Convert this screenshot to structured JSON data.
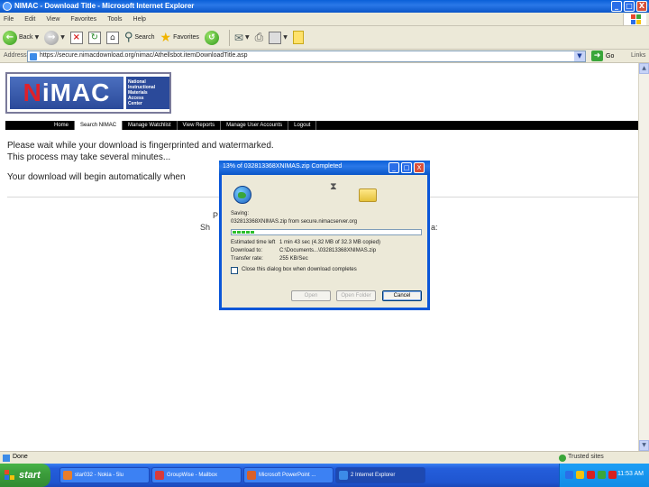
{
  "window": {
    "title": "NIMAC - Download Title - Microsoft Internet Explorer",
    "minimize": "_",
    "maximize": "□",
    "close": "X"
  },
  "menu": [
    "File",
    "Edit",
    "View",
    "Favorites",
    "Tools",
    "Help"
  ],
  "toolbar": {
    "back": "Back",
    "search": "Search",
    "favorites": "Favorites"
  },
  "address": {
    "label": "Address",
    "url": "https://secure.nimacdownload.org/nimac/Athellsbot.itemDownloadTitle.asp",
    "go": "Go",
    "links": "Links"
  },
  "logo": {
    "brand": "NiMAC",
    "subtitle_lines": [
      "National",
      "Instructional",
      "Materials",
      "Access",
      "Center"
    ]
  },
  "nav": [
    "Home",
    "Search NIMAC",
    "Manage Watchlist",
    "View Reports",
    "Manage User Accounts",
    "Logout"
  ],
  "nav_active_index": 1,
  "messages": {
    "line1": "Please wait while your download is fingerprinted and watermarked.",
    "line2": "This process may take several minutes...",
    "line3": "Your download will begin automatically when",
    "frag1": "P",
    "frag2": "Sh",
    "frag3": "a:"
  },
  "dialog": {
    "title": "13% of 032813368XNIMAS.zip Completed",
    "minimize": "_",
    "maximize": "□",
    "close": "X",
    "status": "Saving:",
    "file_from": "032813368XNIMAS.zip from secure.nimacserver.org",
    "progress_fraction": 0.13,
    "est_label": "Estimated time left",
    "est_value": "1 min 43 sec (4.32 MB of 32.3 MB copied)",
    "dl_label": "Download to:",
    "dl_value": "C:\\Documents...\\032813368XNIMAS.zip",
    "rate_label": "Transfer rate:",
    "rate_value": "255 KB/Sec",
    "checkbox_label": "Close this dialog box when download completes",
    "open_btn": "Open",
    "open_folder_btn": "Open Folder",
    "cancel_btn": "Cancel"
  },
  "statusbar": {
    "text": "Done",
    "zone": "Trusted sites"
  },
  "taskbar": {
    "start": "start",
    "tasks": [
      "star032 - Nokia - 5lu",
      "GroupWise - Mailbox",
      "Microsoft PowerPoint ...",
      "2 Internet Explorer"
    ],
    "active_index": 3,
    "clock": "11:53 AM"
  }
}
